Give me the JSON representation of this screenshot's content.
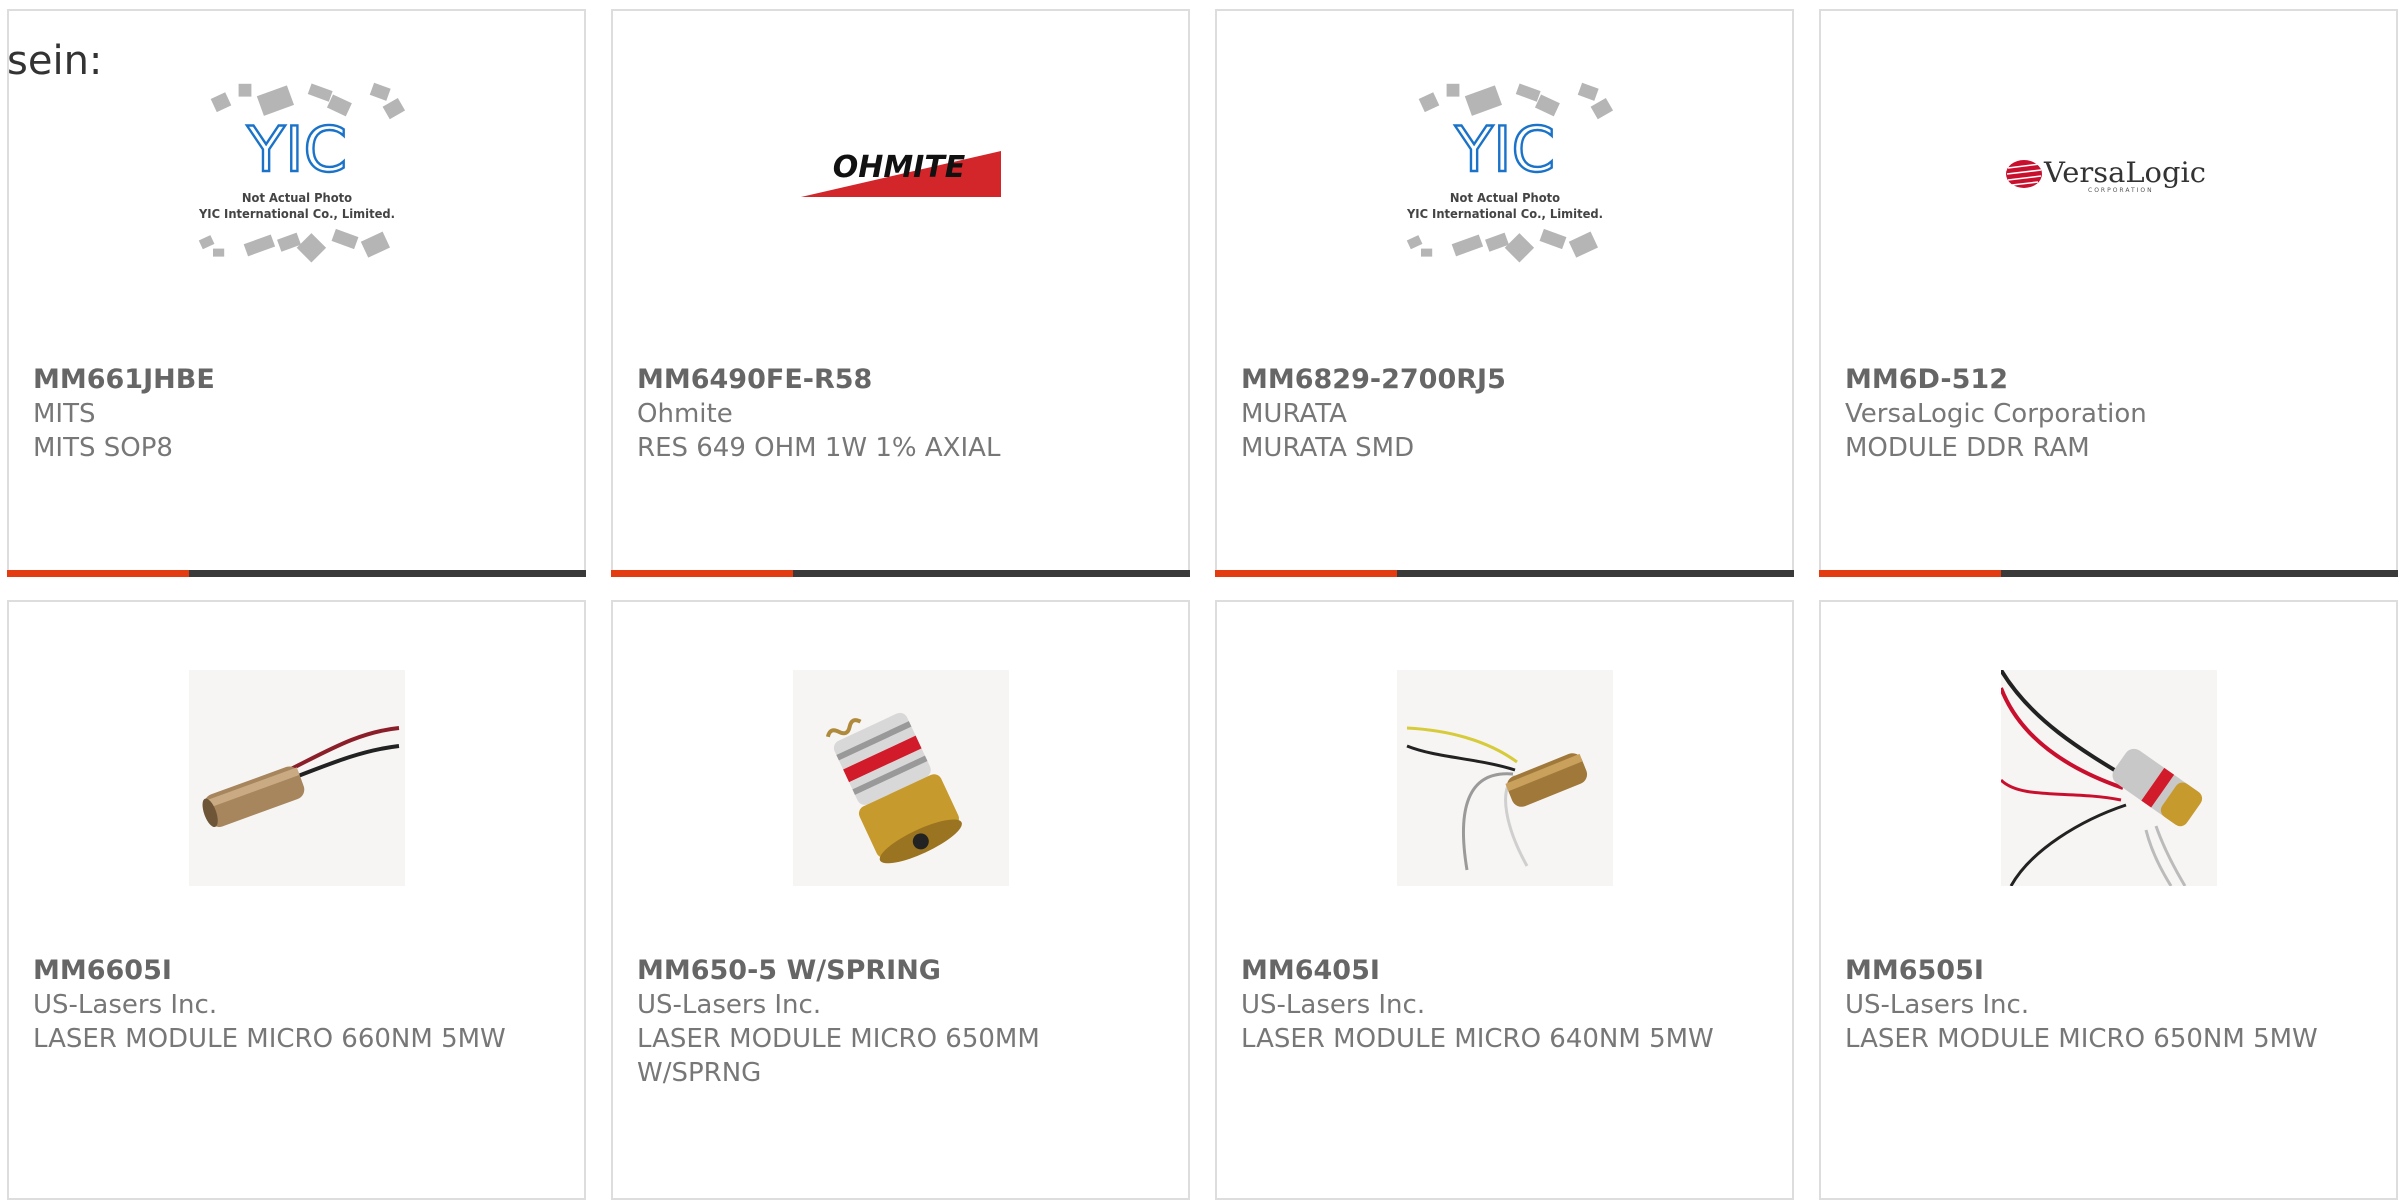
{
  "prefix_text": "sein:",
  "colors": {
    "accent": "#e23c10",
    "bar": "#3a3a3a",
    "border": "#dddddd",
    "text": "#666666"
  },
  "placeholder": {
    "logo": "YIC",
    "line1": "Not Actual Photo",
    "line2": "YIC International Co., Limited."
  },
  "brand_logos": {
    "ohmite": "OHMITE",
    "versalogic": "VersaLogic",
    "versalogic_sub": "CORPORATION"
  },
  "products": [
    {
      "part": "MM661JHBE",
      "manufacturer": "MITS",
      "description": "MITS SOP8",
      "image": "placeholder"
    },
    {
      "part": "MM6490FE-R58",
      "manufacturer": "Ohmite",
      "description": "RES 649 OHM 1W 1% AXIAL",
      "image": "ohmite-logo"
    },
    {
      "part": "MM6829-2700RJ5",
      "manufacturer": "MURATA",
      "description": "MURATA SMD",
      "image": "placeholder"
    },
    {
      "part": "MM6D-512",
      "manufacturer": "VersaLogic Corporation",
      "description": "MODULE DDR RAM",
      "image": "versalogic-logo"
    },
    {
      "part": "MM6605I",
      "manufacturer": "US-Lasers Inc.",
      "description": "LASER MODULE MICRO 660NM 5MW",
      "image": "laser-module"
    },
    {
      "part": "MM650-5 W/SPRING",
      "manufacturer": "US-Lasers Inc.",
      "description": "LASER MODULE MICRO 650MM W/SPRNG",
      "image": "laser-module-spring"
    },
    {
      "part": "MM6405I",
      "manufacturer": "US-Lasers Inc.",
      "description": "LASER MODULE MICRO 640NM 5MW",
      "image": "laser-module"
    },
    {
      "part": "MM6505I",
      "manufacturer": "US-Lasers Inc.",
      "description": "LASER MODULE MICRO 650NM 5MW",
      "image": "laser-module"
    }
  ]
}
